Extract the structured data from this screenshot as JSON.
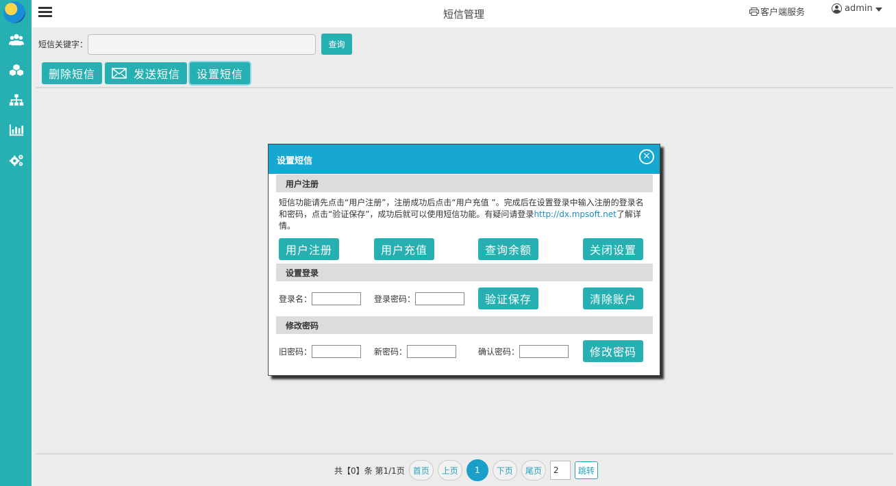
{
  "header": {
    "title": "短信管理",
    "client_service": "客户端服务",
    "user": "admin"
  },
  "toolbar": {
    "search_label": "短信关键字：",
    "search_value": "",
    "query": "查询",
    "delete": "删除短信",
    "send": "发送短信",
    "setup": "设置短信"
  },
  "modal": {
    "title": "设置短信",
    "close": "×",
    "register_section": "用户注册",
    "desc_text": "短信功能请先点击“用户注册”，注册成功后点击“用户充值 ”。完成后在设置登录中输入注册的登录名和密码，点击“验证保存”，成功后就可以使用短信功能。有疑问请登录",
    "desc_link": "http://dx.mpsoft.net",
    "desc_tail": "了解详情。",
    "register_btn": "用户注册",
    "recharge_btn": "用户充值",
    "balance_btn": "查询余额",
    "close_setup_btn": "关闭设置",
    "login_section": "设置登录",
    "login_name_label": "登录名：",
    "login_pwd_label": "登录密码：",
    "verify_save_btn": "验证保存",
    "clear_account_btn": "清除账户",
    "pwd_section": "修改密码",
    "old_pwd_label": "旧密码：",
    "new_pwd_label": "新密码：",
    "confirm_pwd_label": "确认密码：",
    "change_pwd_btn": "修改密码"
  },
  "pager": {
    "summary": "共【0】条 第1/1页",
    "first": "首页",
    "prev": "上页",
    "current": "1",
    "next": "下页",
    "last": "尾页",
    "goto_value": "2",
    "goto": "跳转"
  },
  "colors": {
    "sidebar": "#26b0b2",
    "button": "#26b0b2",
    "modal_header": "#17a8d2",
    "pager_current": "#1aa0c8"
  },
  "icons": {
    "sidebar": [
      "users-icon",
      "cubes-icon",
      "sitemap-icon",
      "bar-chart-icon",
      "cogs-icon"
    ]
  }
}
